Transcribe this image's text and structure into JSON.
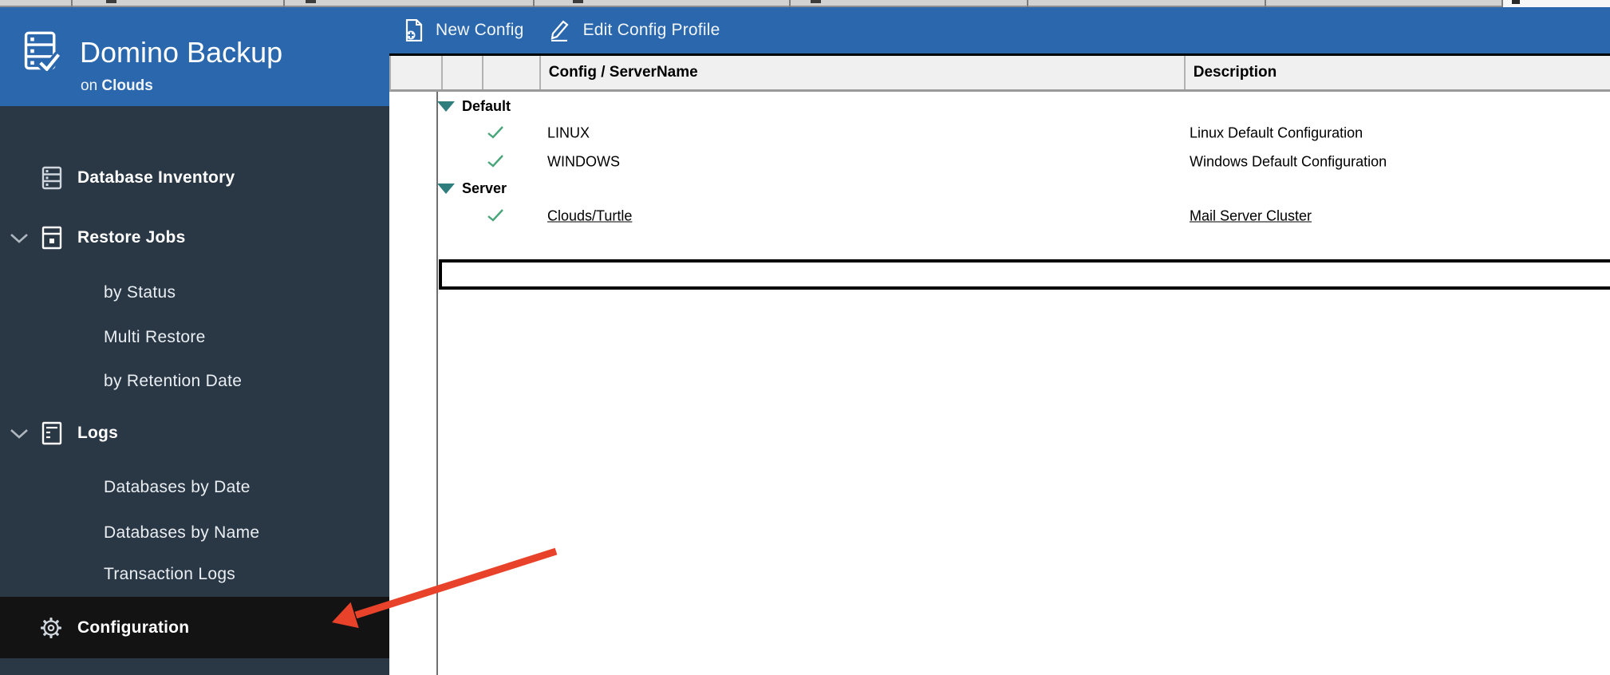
{
  "app": {
    "title": "Domino Backup",
    "subtitle_prefix": "on ",
    "subtitle_name": "Clouds"
  },
  "toolbar": {
    "buttons": [
      {
        "label": "New Config",
        "icon": "new-document-icon"
      },
      {
        "label": "Edit Config Profile",
        "icon": "edit-pencil-icon"
      }
    ]
  },
  "sidebar": {
    "items": [
      {
        "id": "database-inventory",
        "label": "Database Inventory",
        "type": "section",
        "icon": "database-table-icon",
        "chevron": false,
        "active": false
      },
      {
        "id": "restore-jobs",
        "label": "Restore Jobs",
        "type": "section",
        "icon": "restore-server-icon",
        "chevron": true,
        "active": false
      },
      {
        "id": "restore-by-status",
        "label": "by Status",
        "type": "subitem",
        "active": false
      },
      {
        "id": "multi-restore",
        "label": "Multi Restore",
        "type": "subitem",
        "active": false
      },
      {
        "id": "by-retention-date",
        "label": "by Retention Date",
        "type": "subitem",
        "active": false
      },
      {
        "id": "logs",
        "label": "Logs",
        "type": "section",
        "icon": "log-file-icon",
        "chevron": true,
        "active": false
      },
      {
        "id": "databases-by-date",
        "label": "Databases by Date",
        "type": "subitem",
        "active": false
      },
      {
        "id": "databases-by-name",
        "label": "Databases by Name",
        "type": "subitem",
        "active": false
      },
      {
        "id": "transaction-logs",
        "label": "Transaction Logs",
        "type": "subitem",
        "active": false
      },
      {
        "id": "configuration",
        "label": "Configuration",
        "type": "section",
        "icon": "gear-icon",
        "chevron": false,
        "active": true
      }
    ]
  },
  "table": {
    "columns": [
      "",
      "",
      "",
      "Config / ServerName",
      "Description"
    ],
    "groups": [
      {
        "label": "Default",
        "rows": [
          {
            "name": "LINUX",
            "description": "Linux Default Configuration",
            "checked": true,
            "selected": false
          },
          {
            "name": "WINDOWS",
            "description": "Windows Default Configuration",
            "checked": true,
            "selected": false
          }
        ]
      },
      {
        "label": "Server",
        "rows": [
          {
            "name": "Clouds/Turtle",
            "description": "Mail Server Cluster",
            "checked": true,
            "selected": true
          }
        ]
      }
    ]
  },
  "annotation": {
    "arrow_points_to": "configuration",
    "arrow_color": "#e8432a"
  },
  "colors": {
    "topbar_blue": "#2a67ad",
    "sidebar_navy": "#2a3744",
    "active_item_bg": "#131313",
    "header_gray": "#f0f0f0",
    "check_green": "#47a578",
    "group_triangle_teal": "#2f7e7e"
  }
}
